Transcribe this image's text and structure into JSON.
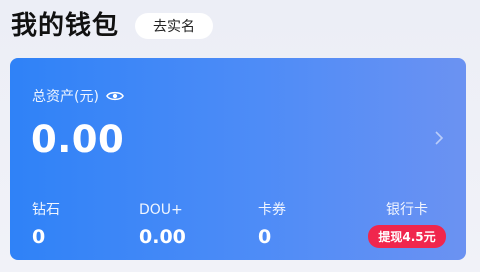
{
  "header": {
    "title": "我的钱包",
    "verify_button": "去实名"
  },
  "balance": {
    "label": "总资产(元)",
    "value": "0.00"
  },
  "stats": [
    {
      "label": "钻石",
      "value": "0"
    },
    {
      "label": "DOU+",
      "value": "0.00"
    },
    {
      "label": "卡券",
      "value": "0"
    }
  ],
  "bank": {
    "label": "银行卡",
    "badge": "提现4.5元"
  },
  "colors": {
    "card_start": "#2f82f7",
    "card_end": "#6b92f2",
    "badge": "#f0264d"
  }
}
